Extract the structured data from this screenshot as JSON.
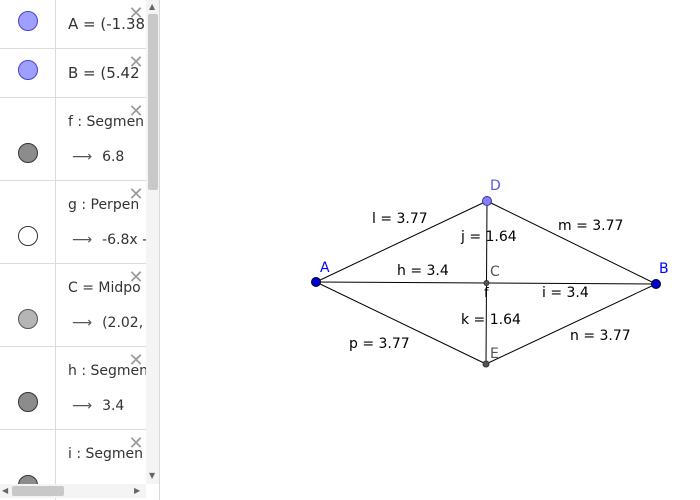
{
  "algebra": {
    "rows": [
      {
        "kind": "single",
        "dot": "blue",
        "def": "A = (-1.38"
      },
      {
        "kind": "single",
        "dot": "blue",
        "def": "B = (5.42"
      },
      {
        "kind": "double",
        "dot": "dark",
        "def": "f : Segmen",
        "value": "6.8"
      },
      {
        "kind": "double",
        "dot": "white",
        "def": "g : Perpen",
        "value": "-6.8x -"
      },
      {
        "kind": "double",
        "dot": "light",
        "def": "C = Midpo",
        "value": "(2.02,"
      },
      {
        "kind": "double",
        "dot": "dark",
        "def": "h : Segmen",
        "value": "3.4"
      },
      {
        "kind": "double",
        "dot": "dark",
        "def": "i : Segmen",
        "value": ""
      }
    ],
    "close_glyph": "✕",
    "arrow_glyph": "⟶"
  },
  "graphics": {
    "points": {
      "A": {
        "label": "A"
      },
      "B": {
        "label": "B"
      },
      "C": {
        "label": "C"
      },
      "D": {
        "label": "D"
      },
      "E": {
        "label": "E"
      }
    },
    "segment_labels": {
      "l": "l = 3.77",
      "m": "m = 3.77",
      "p": "p = 3.77",
      "n": "n = 3.77",
      "j": "j = 1.64",
      "k": "k = 1.64",
      "h": "h = 3.4",
      "i": "i = 3.4",
      "f": "f"
    },
    "colors": {
      "free_point": "#0000cc",
      "free_point_label": "#0000ff",
      "dependent_point": "#555555",
      "point_D_fill": "#7f7fff",
      "point_D_label": "#5a5ae0",
      "segment": "#000000"
    }
  }
}
